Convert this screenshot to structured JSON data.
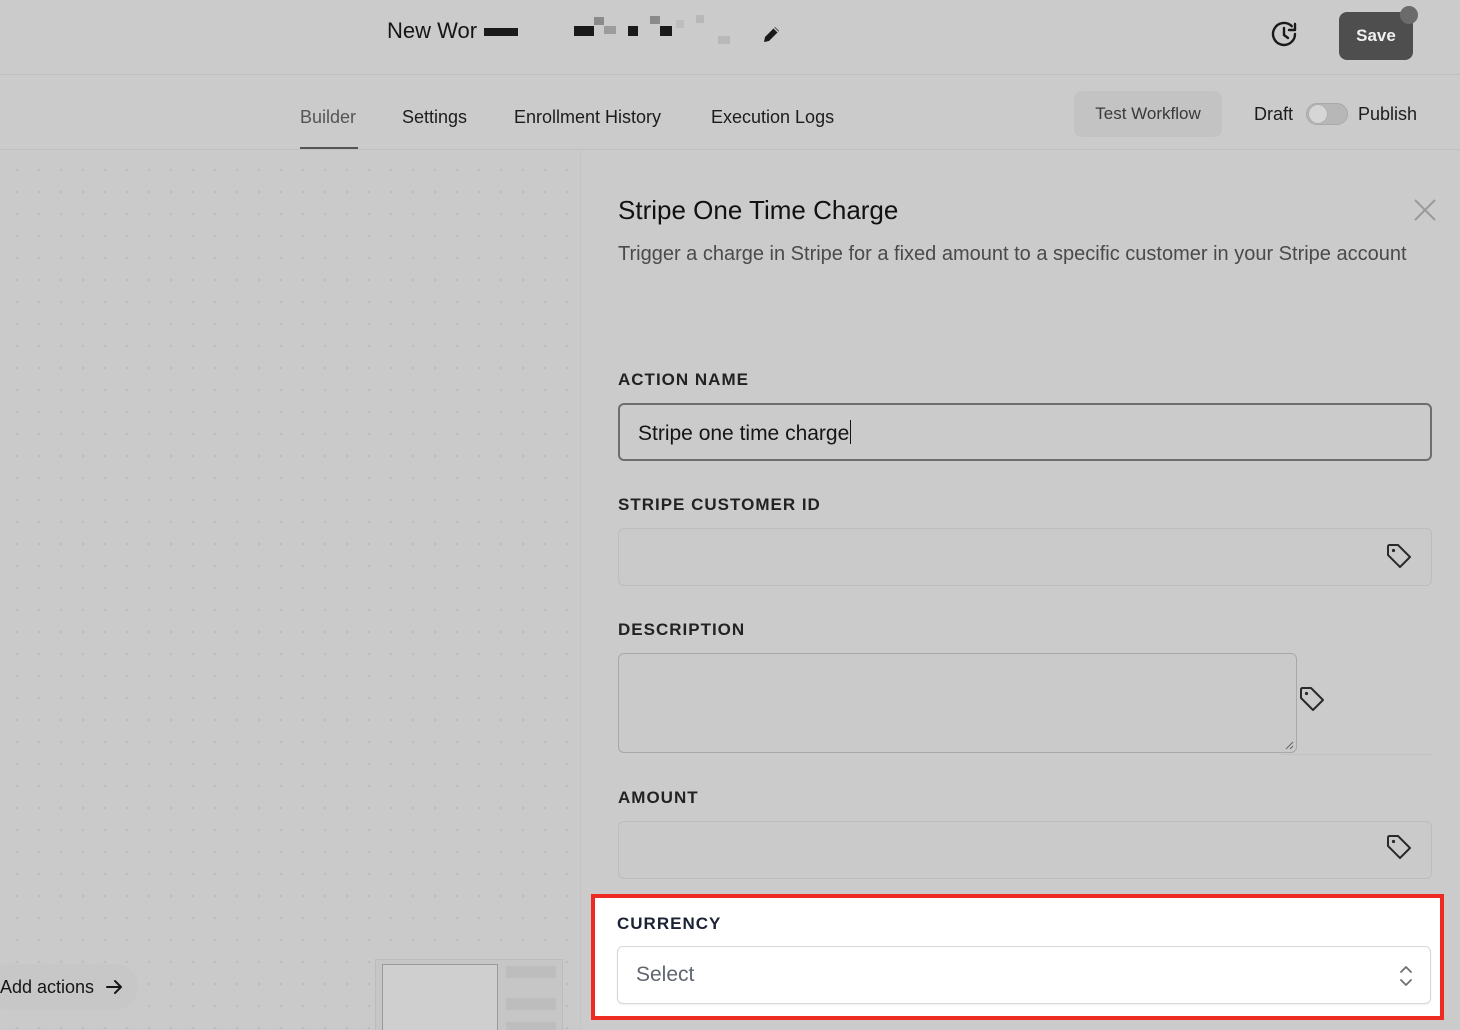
{
  "header": {
    "workflow_title": "New Wor",
    "save_label": "Save"
  },
  "nav": {
    "tabs": [
      {
        "label": "Builder"
      },
      {
        "label": "Settings"
      },
      {
        "label": "Enrollment History"
      },
      {
        "label": "Execution Logs"
      }
    ],
    "test_workflow_label": "Test Workflow",
    "draft_label": "Draft",
    "publish_label": "Publish"
  },
  "canvas": {
    "add_actions_label": "Add actions"
  },
  "panel": {
    "title": "Stripe One Time Charge",
    "description": "Trigger a charge in Stripe for a fixed amount to a specific customer in your Stripe account",
    "fields": {
      "action_name": {
        "label": "ACTION NAME",
        "value": "Stripe one time charge"
      },
      "customer_id": {
        "label": "STRIPE CUSTOMER ID",
        "value": ""
      },
      "description": {
        "label": "DESCRIPTION",
        "value": ""
      },
      "amount": {
        "label": "AMOUNT",
        "value": ""
      },
      "currency": {
        "label": "CURRENCY",
        "value": "Select"
      }
    }
  },
  "colors": {
    "highlight": "#ee2b22",
    "save_button": "#4e4e4e"
  },
  "icons": [
    "edit-icon",
    "history-icon",
    "close-icon",
    "tag-icon",
    "arrow-right-icon",
    "chevron-updown-icon"
  ]
}
